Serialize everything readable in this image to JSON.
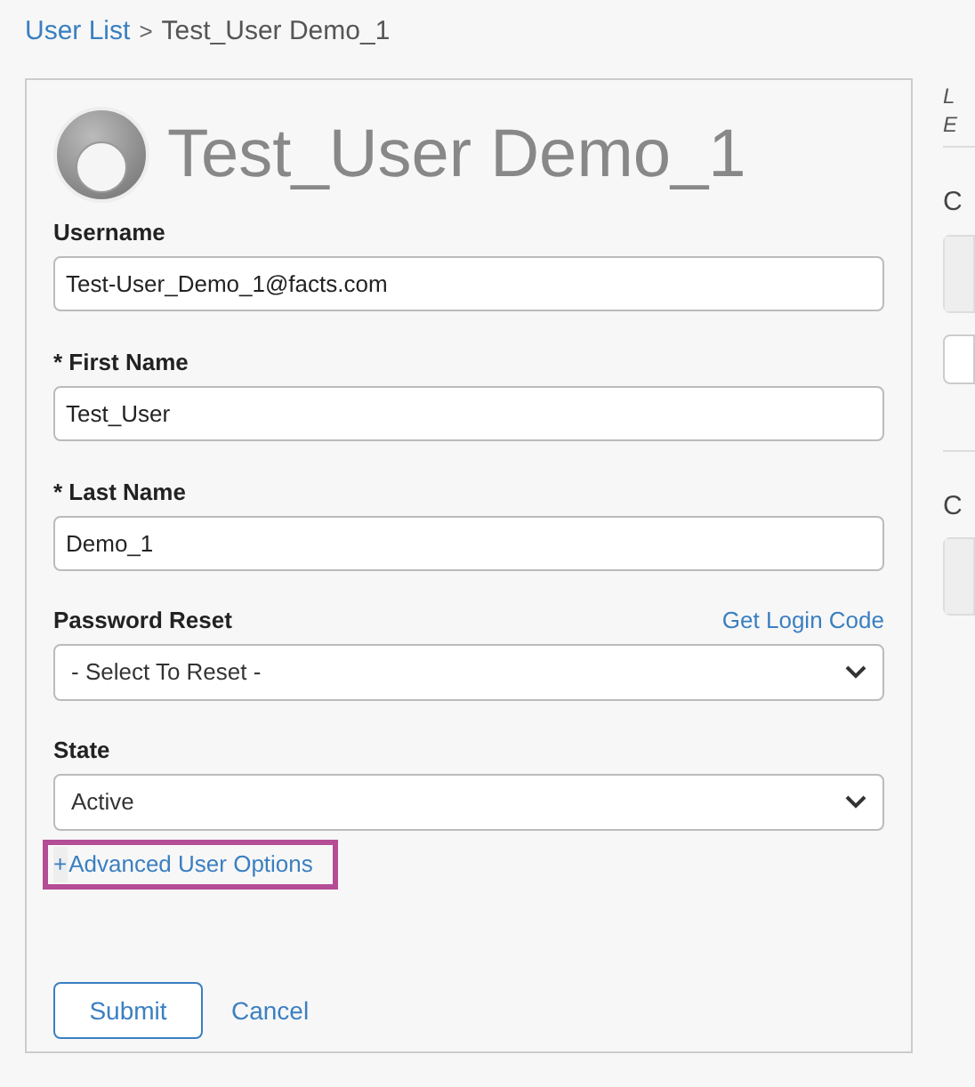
{
  "breadcrumb": {
    "link": "User List",
    "separator": ">",
    "current": "Test_User Demo_1"
  },
  "profile": {
    "title": "Test_User Demo_1"
  },
  "fields": [
    {
      "kind": "text",
      "label": "Username",
      "value": "Test-User_Demo_1@facts.com"
    },
    {
      "kind": "text",
      "label": "* First Name",
      "value": "Test_User"
    },
    {
      "kind": "text",
      "label": "* Last Name",
      "value": "Demo_1"
    },
    {
      "kind": "select",
      "label": "Password Reset",
      "value": "- Select To Reset -",
      "link": "Get Login Code"
    },
    {
      "kind": "select",
      "label": "State",
      "value": "Active"
    }
  ],
  "advanced": {
    "icon": "+",
    "label": "Advanced User Options",
    "highlighted": true
  },
  "buttons": {
    "submit": "Submit",
    "cancel": "Cancel"
  },
  "side_panel": {
    "note_lines": [
      "L",
      "E"
    ],
    "sections": [
      {
        "heading": "C",
        "extra_box": true
      },
      {
        "heading": "C",
        "extra_box": false
      }
    ]
  }
}
